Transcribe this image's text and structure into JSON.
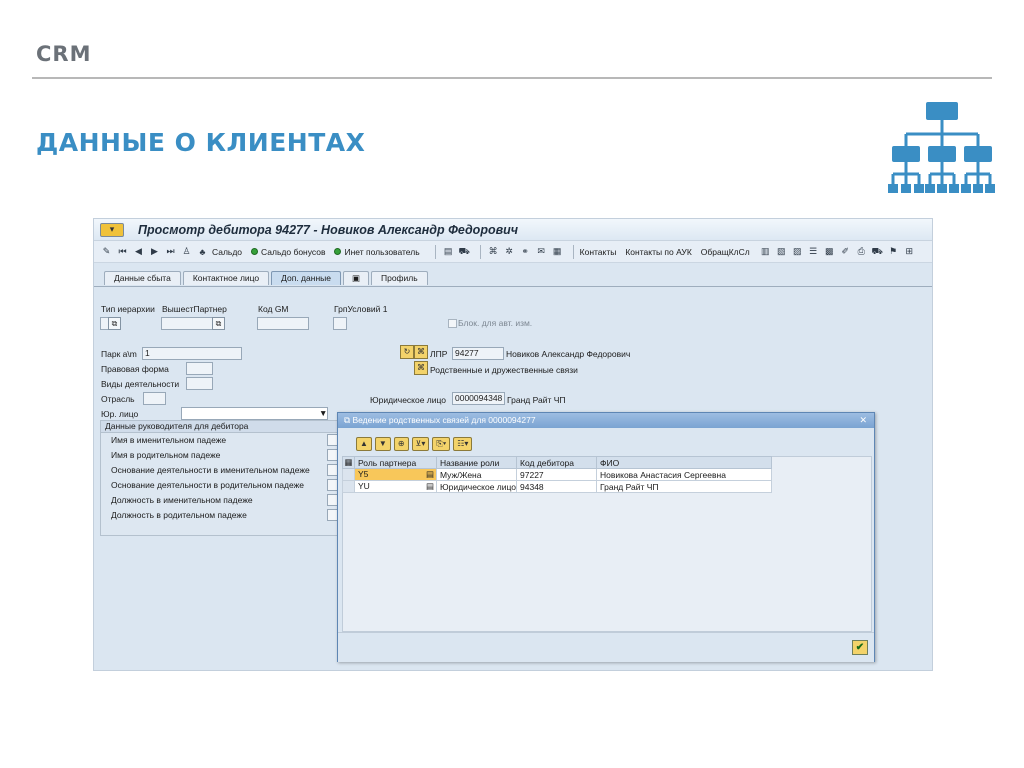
{
  "slide": {
    "brand": "CRM",
    "title": "ДАННЫЕ О КЛИЕНТАХ",
    "accent_color": "#3a8ec4",
    "icon": "org-chart-icon"
  },
  "window": {
    "title": "Просмотр дебитора 94277 - Новиков Александр Федорович"
  },
  "toolbar": {
    "saldo": "Сальдо",
    "saldo_bonus": "Сальдо бонусов",
    "inet_user": "Инет пользователь",
    "contacts": "Контакты",
    "contacts_auk": "Контакты по АУК",
    "obrash": "ОбращКлСл"
  },
  "tabs": [
    "Данные сбыта",
    "Контактное лицо",
    "Доп. данные",
    "Профиль"
  ],
  "form": {
    "tip_ierarhii": "Тип иерархии",
    "vyshest_partner": "ВышестПартнер",
    "kod_gm": "Код GM",
    "grp_usloviy": "ГрпУсловий 1",
    "blok": "Блок. для авт. изм.",
    "park_label": "Парк а\\m",
    "park_value": "1",
    "pravovaya_forma": "Правовая форма",
    "vidy_deyat": "Виды деятельности",
    "otrasl": "Отрасль",
    "yur_lico_label": "Юр. лицо",
    "lpr_label": "ЛПР",
    "lpr_code": "94277",
    "lpr_name": "Новиков Александр Федорович",
    "rodstv_svyazi": "Родственные и дружественные связи",
    "yur_lico2_label": "Юридическое лицо",
    "yur_lico2_code": "0000094348",
    "yur_lico2_name": "Гранд Райт ЧП"
  },
  "manager_group": {
    "title": "Данные руководителя для дебитора",
    "rows": [
      "Имя в именительном падеже",
      "Имя в родительном падеже",
      "Основание деятельности в именительном падеже",
      "Основание деятельности в родительном падеже",
      "Должность в именительном падеже",
      "Должность в родительном падеже"
    ]
  },
  "dialog": {
    "title": "Ведение родственных связей для 0000094277",
    "columns": [
      "Роль партнера",
      "Название роли",
      "Код дебитора",
      "ФИО"
    ],
    "rows": [
      {
        "role": "Y5",
        "role_name": "Муж/Жена",
        "debtor": "97227",
        "fio": "Новикова Анастасия Сергеевна"
      },
      {
        "role": "YU",
        "role_name": "Юридическое лицо",
        "debtor": "94348",
        "fio": "Гранд Райт ЧП"
      }
    ]
  }
}
